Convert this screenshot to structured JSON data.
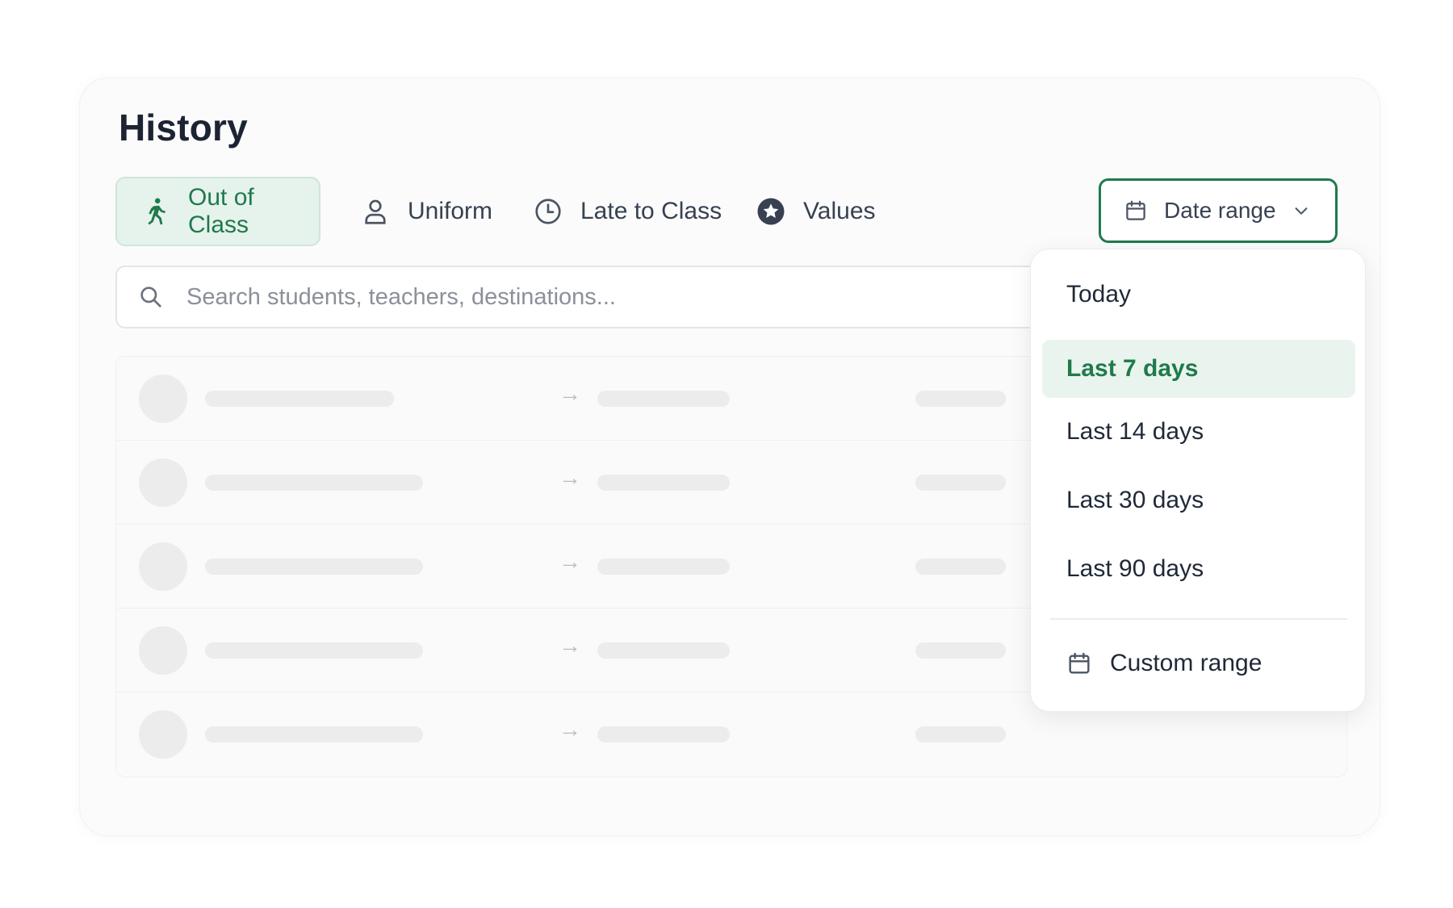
{
  "page": {
    "title": "History"
  },
  "tabs": [
    {
      "label": "Out of Class",
      "icon": "person-walking-icon",
      "active": true
    },
    {
      "label": "Uniform",
      "icon": "person-icon",
      "active": false
    },
    {
      "label": "Late to Class",
      "icon": "clock-icon",
      "active": false
    },
    {
      "label": "Values",
      "icon": "star-icon",
      "active": false
    }
  ],
  "date_range": {
    "label": "Date range",
    "icon": "calendar-icon",
    "chevron": "chevron-down-icon"
  },
  "search": {
    "placeholder": "Search students, teachers, destinations..."
  },
  "rows": [
    {
      "arrow": "→"
    },
    {
      "arrow": "→"
    },
    {
      "arrow": "→"
    },
    {
      "arrow": "→"
    },
    {
      "arrow": "→"
    }
  ],
  "dropdown": {
    "options": [
      {
        "label": "Today",
        "selected": false
      },
      {
        "label": "Last 7 days",
        "selected": true
      },
      {
        "label": "Last 14 days",
        "selected": false
      },
      {
        "label": "Last 30 days",
        "selected": false
      },
      {
        "label": "Last 90 days",
        "selected": false
      }
    ],
    "custom": {
      "label": "Custom range",
      "icon": "calendar-icon"
    }
  },
  "colors": {
    "accent": "#1f7a4c",
    "accent_bg": "#e6f2ec",
    "skeleton": "#ececec",
    "text": "#1f2937"
  }
}
